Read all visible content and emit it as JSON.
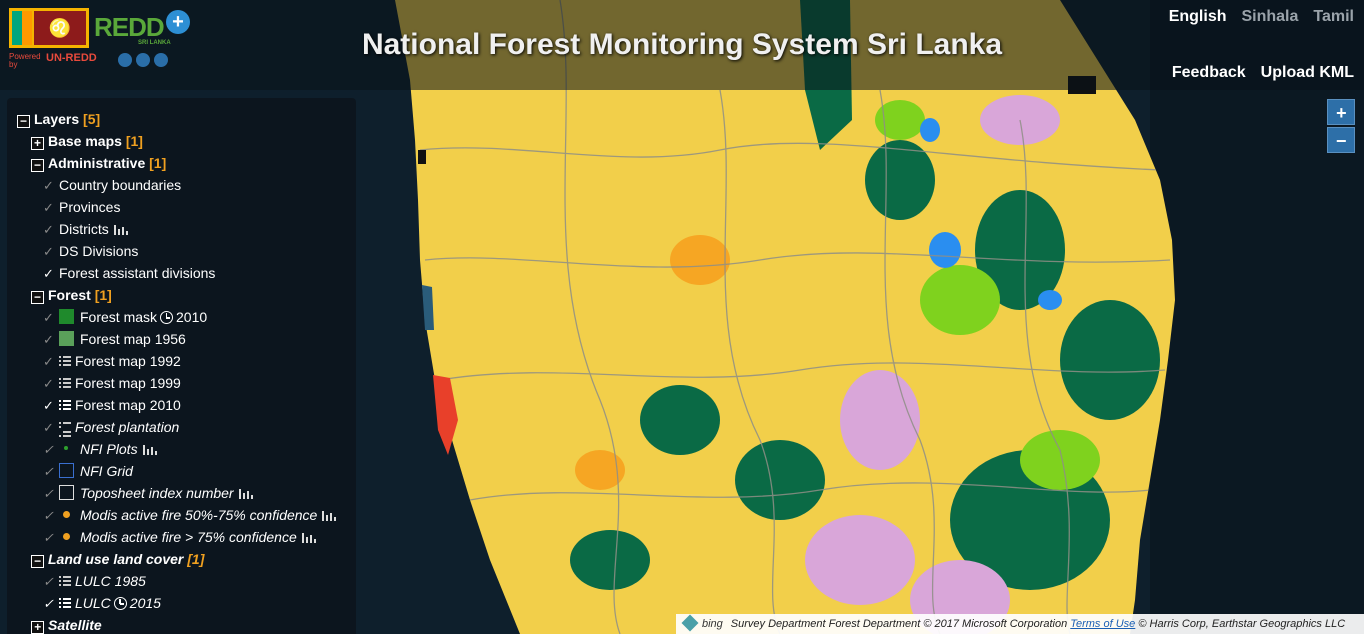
{
  "header": {
    "title": "National Forest Monitoring System Sri Lanka",
    "powered_by": "Powered by",
    "logo_text": "REDD",
    "logo_sub": "SRI LANKA",
    "partner_text": "UN-REDD",
    "languages": [
      "English",
      "Sinhala",
      "Tamil"
    ],
    "active_language": "English",
    "links": [
      "Feedback",
      "Upload KML"
    ]
  },
  "layers": {
    "root_label": "Layers",
    "root_count": "[5]",
    "groups": {
      "base_maps": {
        "label": "Base maps",
        "count": "[1]"
      },
      "administrative": {
        "label": "Administrative",
        "count": "[1]"
      },
      "forest": {
        "label": "Forest",
        "count": "[1]"
      },
      "lulc": {
        "label": "Land use land cover",
        "count": "[1]"
      },
      "satellite": {
        "label": "Satellite"
      }
    },
    "admin_items": [
      "Country boundaries",
      "Provinces",
      "Districts",
      "DS Divisions",
      "Forest assistant divisions"
    ],
    "forest_items": [
      "Forest mask",
      "Forest map 1956",
      "Forest map 1992",
      "Forest map 1999",
      "Forest map 2010",
      "Forest plantation",
      "NFI Plots",
      "NFI Grid",
      "Toposheet index number",
      "Modis active fire 50%-75% confidence",
      "Modis active fire > 75% confidence"
    ],
    "forest_mask_year": "2010",
    "lulc_items": [
      "LULC 1985",
      "LULC"
    ],
    "lulc_year": "2015"
  },
  "zoom": {
    "in": "+",
    "out": "−"
  },
  "attribution": {
    "bing": "bing",
    "text": "Survey Department Forest Department © 2017 Microsoft Corporation",
    "terms": "Terms of Use",
    "tail": "© Harris Corp, Earthstar Geographics LLC"
  }
}
